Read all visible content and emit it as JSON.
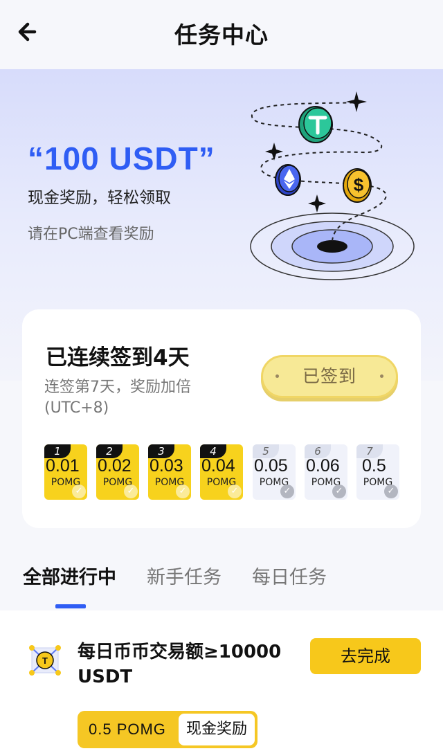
{
  "header": {
    "title": "任务中心",
    "back_icon": "arrow-left-icon"
  },
  "hero": {
    "amount": "“100 USDT”",
    "subtitle": "现金奖励，轻松领取",
    "note": "请在PC端查看奖励"
  },
  "checkin": {
    "title": "已连续签到4天",
    "subtitle": "连签第7天，奖励加倍(UTC+8)",
    "button_label": "已签到",
    "days": [
      {
        "num": "1",
        "value": "0.01",
        "unit": "POMG",
        "done": true
      },
      {
        "num": "2",
        "value": "0.02",
        "unit": "POMG",
        "done": true
      },
      {
        "num": "3",
        "value": "0.03",
        "unit": "POMG",
        "done": true
      },
      {
        "num": "4",
        "value": "0.04",
        "unit": "POMG",
        "done": true
      },
      {
        "num": "5",
        "value": "0.05",
        "unit": "POMG",
        "done": false
      },
      {
        "num": "6",
        "value": "0.06",
        "unit": "POMG",
        "done": false
      },
      {
        "num": "7",
        "value": "0.5",
        "unit": "POMG",
        "done": false
      }
    ]
  },
  "tabs": [
    {
      "label": "全部进行中",
      "active": true
    },
    {
      "label": "新手任务",
      "active": false
    },
    {
      "label": "每日任务",
      "active": false
    }
  ],
  "tasks": [
    {
      "title": "每日币币交易额≥10000 USDT",
      "button_label": "去完成",
      "reward_amount": "0.5 POMG",
      "reward_type": "现金奖励"
    }
  ],
  "colors": {
    "accent": "#2f5df4",
    "yellow": "#f7d21d",
    "page_bg": "#f6f7fb"
  }
}
